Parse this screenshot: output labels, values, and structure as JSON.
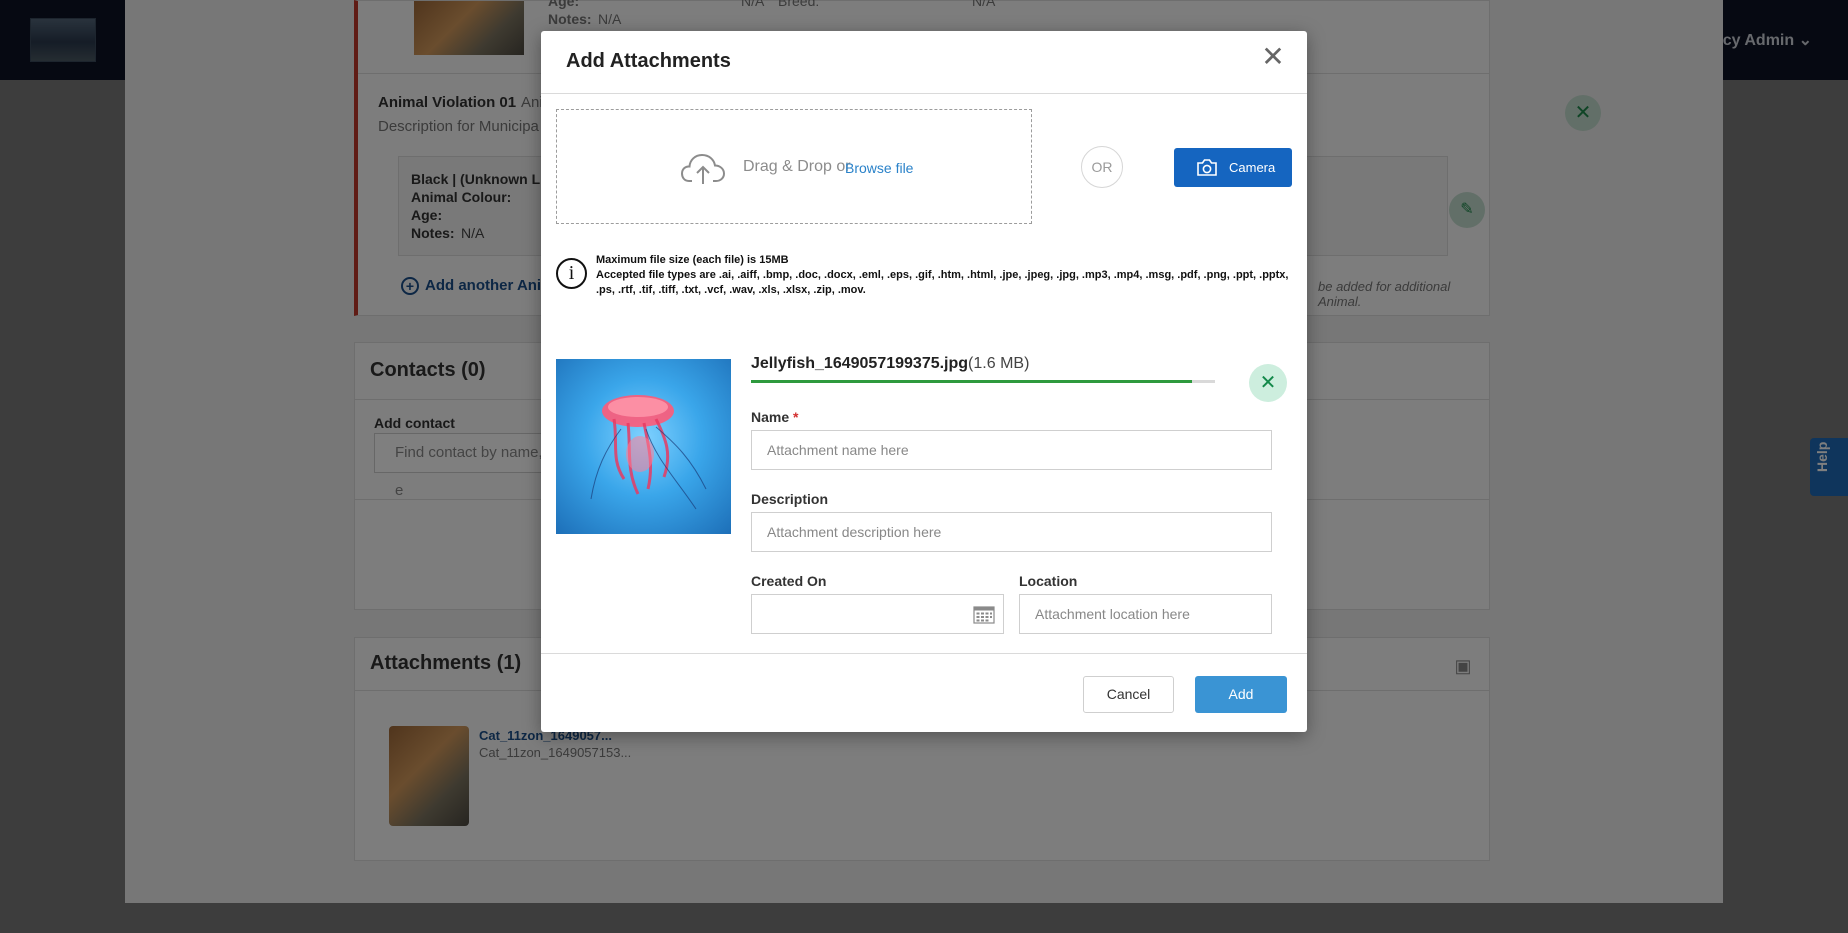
{
  "background": {
    "user_menu": "Agency Admin",
    "top_pet": {
      "age_label": "Age:",
      "notes_label": "Notes:",
      "notes_value": "N/A",
      "val1": "N/A",
      "breed_label": "Breed:",
      "val2": "N/A"
    },
    "violation": {
      "title": "Animal Violation 01",
      "title_suffix": "Ani",
      "description": "Description for Municipa",
      "animal_summary": "Black | (Unknown Lic",
      "colour_label": "Animal Colour:",
      "age_label": "Age:",
      "notes_label": "Notes:",
      "notes_value": "N/A",
      "add_another": "Add another Anima",
      "hint": "be added for additional Animal."
    },
    "contacts": {
      "title": "Contacts (0)",
      "add_label": "Add contact",
      "find_placeholder": "Find contact by name, e"
    },
    "attachments": {
      "title": "Attachments (1)",
      "file_title": "Cat_11zon_1649057...",
      "file_sub": "Cat_11zon_1649057153..."
    },
    "help_label": "Help"
  },
  "modal": {
    "title": "Add Attachments",
    "dropzone": {
      "drag_text": "Drag & Drop or",
      "browse_link": "Browse file"
    },
    "or_label": "OR",
    "camera_label": "Camera",
    "info": {
      "max_size": "Maximum file size (each file) is 15MB",
      "accepted": "Accepted file types are .ai, .aiff, .bmp, .doc, .docx, .eml, .eps, .gif, .htm, .html, .jpe, .jpeg, .jpg, .mp3, .mp4, .msg, .pdf, .png, .ppt, .pptx, .ps, .rtf, .tif, .tiff, .txt, .vcf, .wav, .xls, .xlsx, .zip, .mov."
    },
    "file": {
      "name": "Jellyfish_1649057199375.jpg",
      "size": "(1.6 MB)",
      "progress": 0.95
    },
    "fields": {
      "name_label": "Name",
      "name_required": "*",
      "name_placeholder": "Attachment name here",
      "description_label": "Description",
      "description_placeholder": "Attachment description here",
      "created_on_label": "Created On",
      "created_on_value": "",
      "location_label": "Location",
      "location_placeholder": "Attachment location here"
    },
    "cancel_label": "Cancel",
    "add_label": "Add"
  },
  "icons": {
    "close": "close-icon",
    "upload": "cloud-upload-icon",
    "camera": "camera-icon",
    "info": "info-icon",
    "remove": "remove-x-icon",
    "calendar": "calendar-icon"
  },
  "colors": {
    "primary": "#1565c0",
    "add_button": "#3a94d4",
    "progress": "#2e9a3e",
    "remove_bg": "#cdeede",
    "required": "#d32f2f",
    "violation_accent": "#c0392b"
  }
}
